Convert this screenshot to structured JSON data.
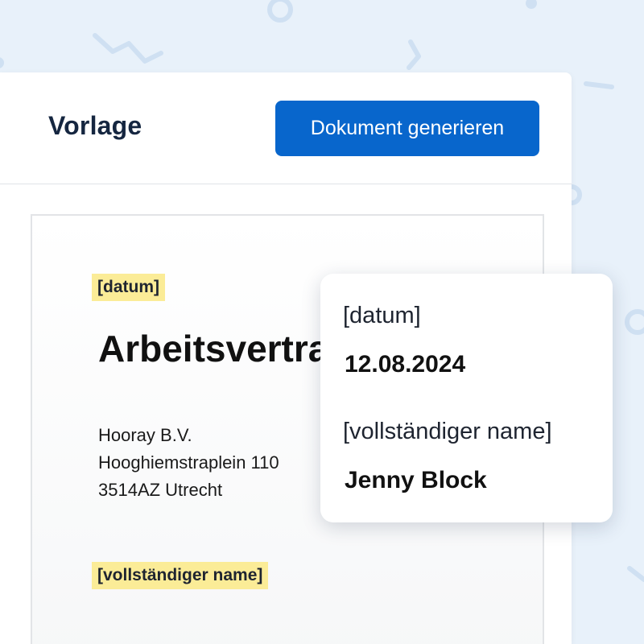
{
  "panel": {
    "title": "Vorlage",
    "generate_button_label": "Dokument generieren"
  },
  "document": {
    "date_tag": "[datum]",
    "heading": "Arbeitsvertrag",
    "address_lines": [
      "Hooray B.V.",
      "Hooghiemstraplein 110",
      "3514AZ Utrecht"
    ],
    "name_tag": "[vollständiger name]"
  },
  "popup": {
    "fields": [
      {
        "label": "[datum]",
        "value": "12.08.2024"
      },
      {
        "label": "[vollständiger name]",
        "value": "Jenny Block"
      }
    ]
  },
  "colors": {
    "accent": "#0866cc",
    "highlight": "#fbec97",
    "background": "#e8f1fa"
  }
}
